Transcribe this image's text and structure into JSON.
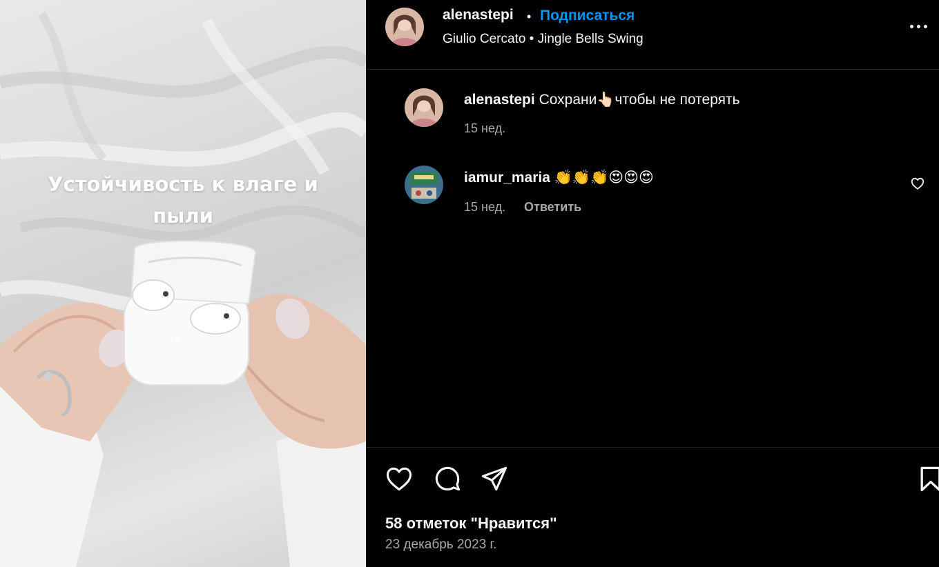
{
  "post": {
    "caption_overlay": "Устойчивость к влаге и пыли"
  },
  "header": {
    "username": "alenastepi",
    "separator": "•",
    "follow_label": "Подписаться",
    "audio": "Giulio Cercato • Jingle Bells Swing",
    "more_icon": "more-horizontal-icon"
  },
  "comments": [
    {
      "username": "alenastepi",
      "text": "Сохрани👆🏻чтобы не потерять",
      "time": "15 нед."
    },
    {
      "username": "iamur_maria",
      "text": "👏👏👏😍😍😍",
      "time": "15 нед.",
      "reply_label": "Ответить"
    }
  ],
  "actions": {
    "like_icon": "heart-icon",
    "comment_icon": "comment-icon",
    "share_icon": "share-icon",
    "save_icon": "bookmark-icon"
  },
  "likes_text": "58 отметок \"Нравится\"",
  "date_text": "23 декабрь 2023 г.",
  "colors": {
    "accent": "#0095f6",
    "background": "#000000",
    "muted": "#a8a8a8"
  }
}
